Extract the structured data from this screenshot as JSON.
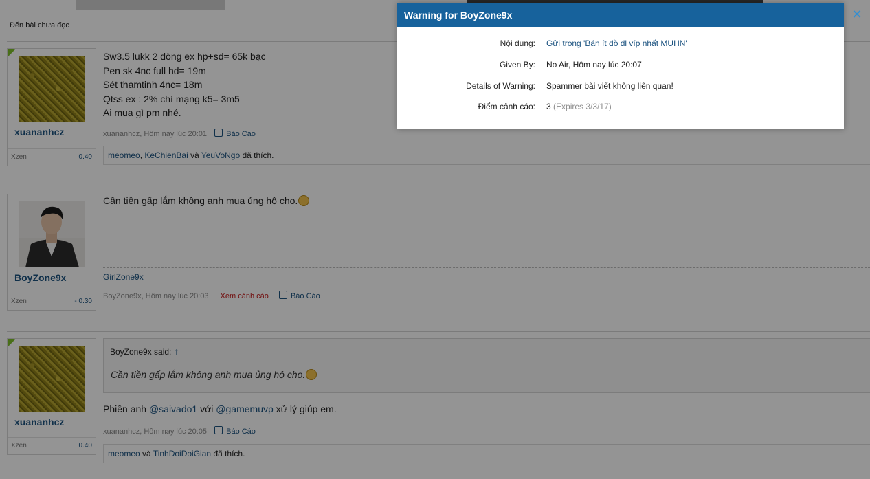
{
  "nav": {
    "unread_link": "Đến bài chưa đọc"
  },
  "posts": [
    {
      "username": "xuananhcz",
      "user_level": "Xzen",
      "user_points": "0.40",
      "lines": [
        "Sw3.5 lukk 2 dòng ex hp+sd= 65k bạc",
        "Pen sk 4nc full hd= 19m",
        "Sét thamtinh 4nc= 18m",
        "Qtss ex : 2% chí mạng k5= 3m5",
        "Ai mua gì pm nhé."
      ],
      "meta": "xuananhcz, Hôm nay lúc 20:01",
      "report_label": "Báo Cáo",
      "likes": {
        "users": [
          "meomeo",
          "KeChienBai",
          "YeuVoNgo"
        ],
        "sep1": ", ",
        "and": " và ",
        "suffix": " đã thích."
      }
    },
    {
      "username": "BoyZone9x",
      "user_level": "Xzen",
      "user_points": "- 0.30",
      "text": "Cần tiền gấp lắm không anh mua ủng hộ cho.",
      "signature": "GirlZone9x",
      "meta": "BoyZone9x, Hôm nay lúc 20:03",
      "warning_link": "Xem cảnh cáo",
      "report_label": "Báo Cáo"
    },
    {
      "username": "xuananhcz",
      "user_level": "Xzen",
      "user_points": "0.40",
      "quote": {
        "author": "BoyZone9x said:",
        "arrow": "↑",
        "text": "Cần tiền gấp lắm không anh mua ủng hộ cho."
      },
      "text_before": "Phiền anh ",
      "mention1": "@saivado1",
      "text_mid": " với ",
      "mention2": "@gamemuvp",
      "text_after": " xử lý giúp em.",
      "meta": "xuananhcz, Hôm nay lúc 20:05",
      "report_label": "Báo Cáo",
      "likes": {
        "users": [
          "meomeo",
          "TinhDoiDoiGian"
        ],
        "and": " và ",
        "suffix": " đã thích."
      }
    }
  ],
  "dialog": {
    "title": "Warning for BoyZone9x",
    "close_icon": "close-icon",
    "rows": [
      {
        "label": "Nội dung:",
        "value": "Gửi trong 'Bán ít đồ dl víp nhất MUHN'"
      },
      {
        "label": "Given By:",
        "value": "No Air, Hôm nay lúc 20:07"
      },
      {
        "label": "Details of Warning:",
        "value": "Spammer bài viết không liên quan!"
      },
      {
        "label": "Điểm cảnh cáo:",
        "value": "3",
        "extra": "(Expires 3/3/17)"
      }
    ]
  },
  "colors": {
    "header": "#17629c",
    "link": "#1c5380",
    "warning": "#c41b1b",
    "close": "#2d8fd6"
  }
}
